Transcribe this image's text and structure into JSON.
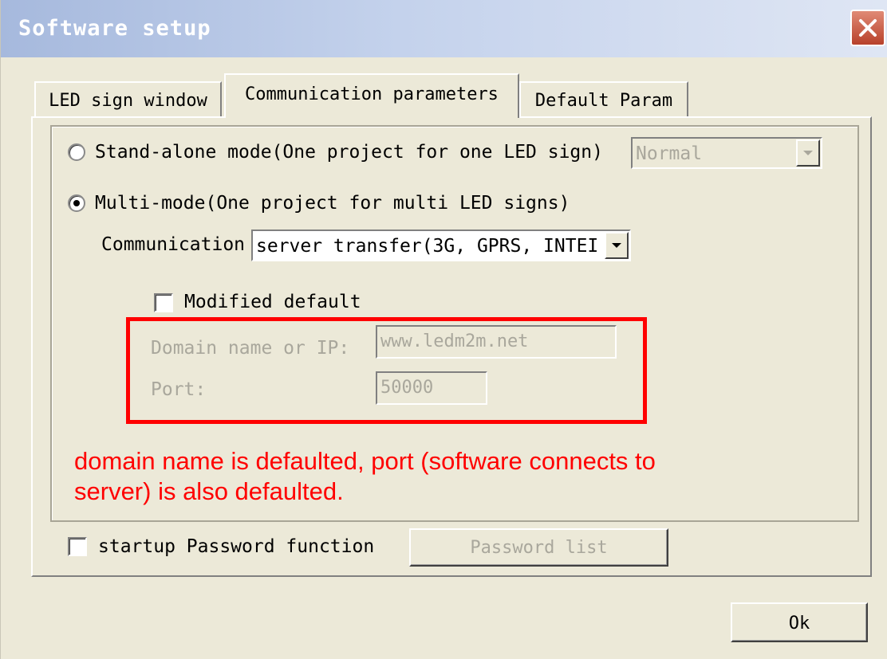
{
  "window": {
    "title": "Software setup"
  },
  "tabs": [
    {
      "label": "LED sign window"
    },
    {
      "label": "Communication parameters"
    },
    {
      "label": "Default Param"
    }
  ],
  "modes": {
    "standalone": {
      "label": "Stand-alone mode(One project for one LED sign)",
      "selected": false
    },
    "standalone_select": {
      "value": "Normal",
      "enabled": false
    },
    "multi": {
      "label": "Multi-mode(One project for multi LED signs)",
      "selected": true
    }
  },
  "communication": {
    "label": "Communication",
    "value": "server transfer(3G, GPRS, INTEI"
  },
  "modified_default": {
    "label": "Modified default",
    "checked": false
  },
  "domain": {
    "label": "Domain name or IP:",
    "value": "www.ledm2m.net",
    "enabled": false
  },
  "port": {
    "label": "Port:",
    "value": "50000",
    "enabled": false
  },
  "annotation": {
    "text": "domain name is defaulted, port (software connects to server) is also defaulted.",
    "color": "#ff0000"
  },
  "password": {
    "checkbox_label": "startup Password function",
    "checked": false,
    "list_button": "Password list"
  },
  "ok_button": "Ok",
  "colors": {
    "titlebar_start": "#a6b9dd",
    "dialog_bg": "#ece9d8",
    "close_red": "#b8412b",
    "highlight": "#ff0000"
  }
}
